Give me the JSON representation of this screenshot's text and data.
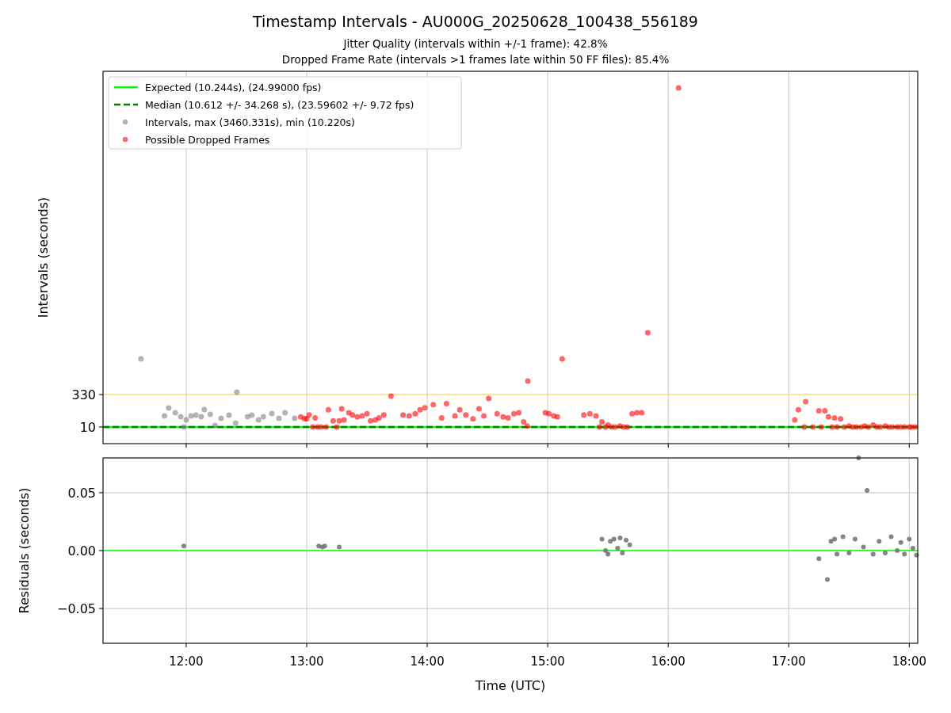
{
  "figure": {
    "title": "Timestamp Intervals - AU000G_20250628_100438_556189",
    "subtitles": [
      "Jitter Quality (intervals within +/-1 frame): 42.8%",
      "Dropped Frame Rate (intervals >1 frames late within 50 FF files): 85.4%"
    ]
  },
  "intervals_chart": {
    "chart_data": {
      "type": "scatter",
      "ylabel": "Intervals (seconds)",
      "xlim": [
        11.31,
        18.07
      ],
      "ylim": [
        -154,
        3518
      ],
      "grid": "x",
      "yticks": [
        {
          "value": 10,
          "label": "10"
        },
        {
          "value": 330,
          "label": "330"
        }
      ],
      "legend": "upper left",
      "ref_lines": [
        {
          "axis": "y",
          "value": 10.244,
          "label": "Expected (10.244s), (24.99000 fps)",
          "color": "#00ff00"
        },
        {
          "axis": "y",
          "value": 10.612,
          "label": "Median (10.612 +/- 34.268 s), (23.59602 +/- 9.72 fps)",
          "color": "#008000"
        },
        {
          "axis": "y",
          "value": 330,
          "color": "#ffd266"
        }
      ],
      "series": [
        {
          "name": "Intervals, max (3460.331s), min (10.220s)",
          "color": "#808080",
          "x": [
            11.625,
            11.82,
            11.855,
            11.91,
            11.955,
            11.98,
            12.0,
            12.04,
            12.08,
            12.125,
            12.15,
            12.2,
            12.24,
            12.29,
            12.355,
            12.41,
            12.42,
            12.51,
            12.545,
            12.6,
            12.64,
            12.71,
            12.77,
            12.82,
            12.9
          ],
          "values": [
            682,
            119,
            197,
            150,
            112,
            10,
            80,
            119,
            127,
            112,
            182,
            135,
            26,
            96,
            127,
            49,
            354,
            112,
            127,
            80,
            112,
            143,
            96,
            150,
            96
          ]
        },
        {
          "name": "Possible Dropped Frames",
          "color": "#ff0000",
          "x": [
            12.95,
            12.98,
            13.0,
            13.02,
            13.05,
            13.07,
            13.09,
            13.12,
            13.16,
            13.18,
            13.22,
            13.25,
            13.27,
            13.29,
            13.31,
            13.35,
            13.38,
            13.42,
            13.46,
            13.5,
            13.53,
            13.57,
            13.6,
            13.64,
            13.7,
            13.8,
            13.85,
            13.9,
            13.94,
            13.98,
            14.05,
            14.12,
            14.16,
            14.23,
            14.27,
            14.32,
            14.38,
            14.43,
            14.47,
            14.51,
            14.58,
            14.63,
            14.67,
            14.72,
            14.76,
            14.8,
            14.835,
            14.83,
            14.98,
            15.01,
            15.05,
            15.08,
            15.12,
            15.3,
            15.35,
            15.4,
            15.43,
            15.45,
            15.48,
            15.5,
            15.53,
            15.56,
            15.6,
            15.63,
            15.66,
            15.7,
            15.74,
            15.78,
            15.83,
            16.086,
            17.05,
            17.08,
            17.13,
            17.14,
            17.2,
            17.25,
            17.27,
            17.3,
            17.33,
            17.36,
            17.38,
            17.4,
            17.43,
            17.46,
            17.5,
            17.53,
            17.56,
            17.6,
            17.63,
            17.66,
            17.7,
            17.73,
            17.76,
            17.8,
            17.83,
            17.86,
            17.9,
            17.93,
            17.96,
            18.0,
            18.02,
            18.05
          ],
          "values": [
            110,
            95,
            90,
            130,
            10,
            100,
            10,
            10,
            10,
            180,
            70,
            10,
            70,
            190,
            80,
            150,
            130,
            110,
            120,
            140,
            70,
            80,
            100,
            130,
            315,
            130,
            120,
            140,
            180,
            200,
            230,
            100,
            240,
            120,
            180,
            130,
            90,
            190,
            120,
            291,
            140,
            110,
            100,
            140,
            150,
            60,
            463,
            20,
            150,
            140,
            120,
            110,
            682,
            130,
            140,
            120,
            10,
            60,
            10,
            30,
            10,
            10,
            20,
            10,
            10,
            140,
            150,
            150,
            940,
            3354,
            80,
            180,
            10,
            260,
            10,
            170,
            10,
            170,
            110,
            10,
            100,
            10,
            90,
            10,
            20,
            10,
            10,
            10,
            20,
            10,
            30,
            10,
            10,
            20,
            10,
            10,
            10,
            10,
            10,
            10,
            10,
            10
          ]
        }
      ]
    }
  },
  "residuals_chart": {
    "chart_data": {
      "type": "scatter",
      "xlabel": "Time (UTC)",
      "ylabel": "Residuals (seconds)",
      "xlim": [
        11.31,
        18.07
      ],
      "ylim": [
        -0.08,
        0.08
      ],
      "grid": "both",
      "xticks": [
        {
          "value": 12,
          "label": "12:00"
        },
        {
          "value": 13,
          "label": "13:00"
        },
        {
          "value": 14,
          "label": "14:00"
        },
        {
          "value": 15,
          "label": "15:00"
        },
        {
          "value": 16,
          "label": "16:00"
        },
        {
          "value": 17,
          "label": "17:00"
        },
        {
          "value": 18,
          "label": "18:00"
        }
      ],
      "yticks": [
        {
          "value": -0.05,
          "label": "−0.05"
        },
        {
          "value": 0,
          "label": "0.00"
        },
        {
          "value": 0.05,
          "label": "0.05"
        }
      ],
      "ref_lines": [
        {
          "axis": "y",
          "value": 0,
          "color": "#00ff00"
        }
      ],
      "series": [
        {
          "color": "#707070",
          "x": [
            11.98,
            13.1,
            13.13,
            13.15,
            13.27,
            15.45,
            15.48,
            15.5,
            15.52,
            15.55,
            15.58,
            15.6,
            15.62,
            15.65,
            15.68,
            17.25,
            17.32,
            17.35,
            17.38,
            17.4,
            17.45,
            17.5,
            17.55,
            17.58,
            17.62,
            17.65,
            17.7,
            17.75,
            17.8,
            17.85,
            17.9,
            17.93,
            17.96,
            18.0,
            18.03,
            18.06
          ],
          "values": [
            0.004,
            0.004,
            0.003,
            0.004,
            0.003,
            0.01,
            0.0,
            -0.003,
            0.008,
            0.01,
            0.002,
            0.011,
            -0.002,
            0.009,
            0.005,
            -0.007,
            -0.025,
            0.008,
            0.01,
            -0.003,
            0.012,
            -0.002,
            0.01,
            0.08,
            0.003,
            0.052,
            -0.003,
            0.008,
            -0.002,
            0.012,
            0.0,
            0.007,
            -0.003,
            0.01,
            0.002,
            -0.004
          ]
        }
      ]
    }
  }
}
